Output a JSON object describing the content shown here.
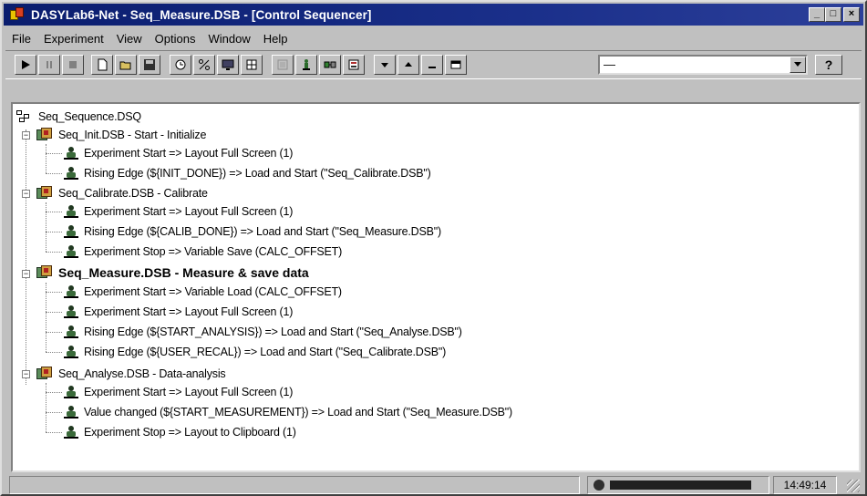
{
  "window": {
    "title": "DASYLab6-Net - Seq_Measure.DSB - [Control Sequencer]",
    "minimize_label": "_",
    "maximize_label": "□",
    "close_label": "×"
  },
  "menu": {
    "items": [
      {
        "label": "File"
      },
      {
        "label": "Experiment"
      },
      {
        "label": "View"
      },
      {
        "label": "Options"
      },
      {
        "label": "Window"
      },
      {
        "label": "Help"
      }
    ]
  },
  "toolbar": {
    "combo_value": "—",
    "help_label": "?"
  },
  "tree": {
    "root": {
      "label": "Seq_Sequence.DSQ"
    },
    "sequences": [
      {
        "label": "Seq_Init.DSB - Start - Initialize",
        "bold": false,
        "actions": [
          {
            "label": "Experiment Start  =>  Layout Full Screen (1)"
          },
          {
            "label": "Rising Edge (${INIT_DONE})  =>  Load and Start (\"Seq_Calibrate.DSB\")"
          }
        ]
      },
      {
        "label": "Seq_Calibrate.DSB - Calibrate",
        "bold": false,
        "actions": [
          {
            "label": "Experiment Start  =>  Layout Full Screen (1)"
          },
          {
            "label": "Rising Edge (${CALIB_DONE})  =>  Load and Start (\"Seq_Measure.DSB\")"
          },
          {
            "label": "Experiment Stop  =>  Variable Save (CALC_OFFSET)"
          }
        ]
      },
      {
        "label": "Seq_Measure.DSB - Measure & save data",
        "bold": true,
        "actions": [
          {
            "label": "Experiment Start  =>  Variable Load (CALC_OFFSET)"
          },
          {
            "label": "Experiment Start  =>  Layout Full Screen (1)"
          },
          {
            "label": "Rising Edge (${START_ANALYSIS})  =>  Load and Start (\"Seq_Analyse.DSB\")"
          },
          {
            "label": "Rising Edge (${USER_RECAL})  =>  Load and Start (\"Seq_Calibrate.DSB\")"
          }
        ]
      },
      {
        "label": "Seq_Analyse.DSB - Data-analysis",
        "bold": false,
        "actions": [
          {
            "label": "Experiment Start  =>  Layout Full Screen (1)"
          },
          {
            "label": "Value changed (${START_MEASUREMENT})  =>  Load and Start (\"Seq_Measure.DSB\")"
          },
          {
            "label": "Experiment Stop  =>  Layout to Clipboard (1)"
          }
        ]
      }
    ]
  },
  "status": {
    "time": "14:49:14",
    "progress": 0.92
  }
}
